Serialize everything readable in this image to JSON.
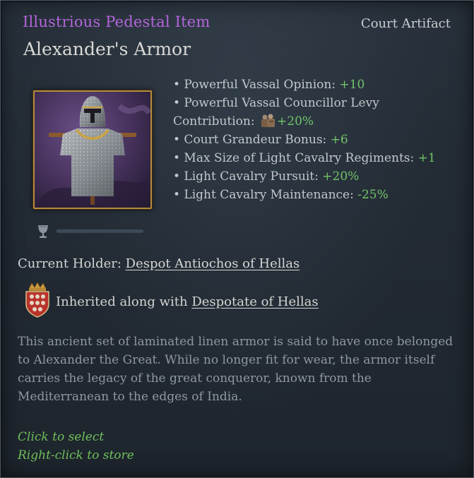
{
  "header": {
    "rarity": "Illustrious Pedestal Item",
    "category": "Court Artifact",
    "title": "Alexander's Armor"
  },
  "colors": {
    "rarity": "#b266d9",
    "positive": "#72c36a",
    "hint": "#6fbf5c",
    "frame": "#b68a3c"
  },
  "artifact_icon": "armor-artifact-icon",
  "modifiers": [
    {
      "label": "• Powerful Vassal Opinion: ",
      "value": "+10"
    },
    {
      "label": "• Powerful Vassal Councillor Levy Contribution: ",
      "icon": "levy-icon",
      "value": "+20%"
    },
    {
      "label": "• Court Grandeur Bonus: ",
      "value": "+6"
    },
    {
      "label": "• Max Size of Light Cavalry Regiments: ",
      "value": "+1"
    },
    {
      "label": "• Light Cavalry Pursuit: ",
      "value": "+20%"
    },
    {
      "label": "• Light Cavalry Maintenance: ",
      "value": "-25%"
    }
  ],
  "quality": {
    "icon": "goblet-icon",
    "level": 0
  },
  "holder": {
    "label": "Current Holder: ",
    "name": "Despot Antiochos of Hellas"
  },
  "inheritance": {
    "icon": "coat-of-arms-icon",
    "label": "Inherited along with ",
    "title": "Despotate of Hellas"
  },
  "description": "This ancient set of laminated linen armor is said to have once belonged to Alexander the Great. While no longer fit for wear, the armor itself carries the legacy of the great conqueror, known from the Mediterranean to the edges of India.",
  "hints": {
    "select": "Click to select",
    "store": "Right-click to store"
  }
}
